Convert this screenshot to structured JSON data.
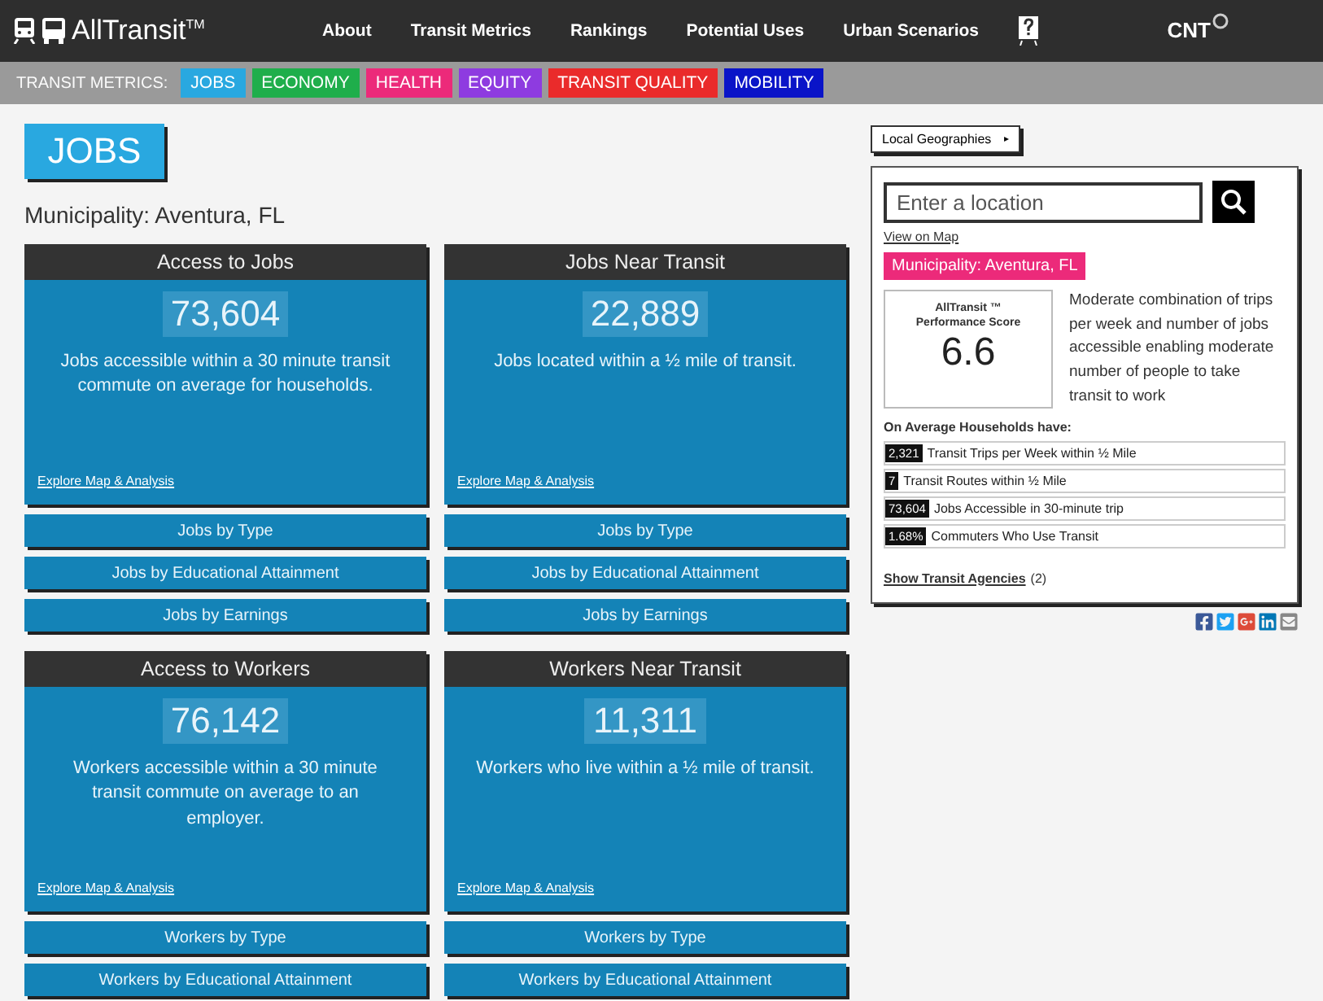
{
  "header": {
    "brand": "AllTransit",
    "brand_mark": "TM",
    "nav": [
      "About",
      "Transit Metrics",
      "Rankings",
      "Potential Uses",
      "Urban Scenarios"
    ],
    "partner_logo": "CNT"
  },
  "metrics_bar": {
    "label": "TRANSIT METRICS:",
    "tabs": [
      {
        "label": "JOBS",
        "color": "#29a8e0"
      },
      {
        "label": "ECONOMY",
        "color": "#1fae4b"
      },
      {
        "label": "HEALTH",
        "color": "#ec2a7a"
      },
      {
        "label": "EQUITY",
        "color": "#8e3be0"
      },
      {
        "label": "TRANSIT QUALITY",
        "color": "#ea2b2b"
      },
      {
        "label": "MOBILITY",
        "color": "#0a14c8"
      }
    ]
  },
  "page_title": "JOBS",
  "place_heading": "Municipality: Aventura, FL",
  "cards": [
    {
      "title": "Access to Jobs",
      "value": "73,604",
      "description": "Jobs accessible within a 30 minute transit commute on average for households.",
      "link": "Explore Map & Analysis",
      "buttons": [
        "Jobs by Type",
        "Jobs by Educational Attainment",
        "Jobs by Earnings"
      ]
    },
    {
      "title": "Jobs Near Transit",
      "value": "22,889",
      "description": "Jobs located within a ½ mile of transit.",
      "link": "Explore Map & Analysis",
      "buttons": [
        "Jobs by Type",
        "Jobs by Educational Attainment",
        "Jobs by Earnings"
      ]
    },
    {
      "title": "Access to Workers",
      "value": "76,142",
      "description": "Workers accessible within a 30 minute transit commute on average to an employer.",
      "link": "Explore Map & Analysis",
      "buttons": [
        "Workers by Type",
        "Workers by Educational Attainment"
      ]
    },
    {
      "title": "Workers Near Transit",
      "value": "11,311",
      "description": "Workers who live within a ½ mile of transit.",
      "link": "Explore Map & Analysis",
      "buttons": [
        "Workers by Type",
        "Workers by Educational Attainment"
      ]
    }
  ],
  "sidebar": {
    "dropdown": "Local Geographies",
    "dropdown_caret": "▸",
    "search": {
      "placeholder": "Enter a location"
    },
    "view_on_map": "View on Map",
    "place_tag": "Municipality: Aventura, FL",
    "score": {
      "label": "AllTransit",
      "label_mark": "™",
      "label_line2": "Performance Score",
      "value": "6.6",
      "description": "Moderate combination of trips per week and number of jobs accessible enabling moderate number of people to take transit to work"
    },
    "stats_heading": "On Average Households have:",
    "stats": [
      {
        "value": "2,321",
        "label": "Transit Trips per Week within ½ Mile"
      },
      {
        "value": "7",
        "label": "Transit Routes within ½ Mile"
      },
      {
        "value": "73,604",
        "label": "Jobs Accessible in 30-minute trip"
      },
      {
        "value": "1.68%",
        "label": "Commuters Who Use Transit"
      }
    ],
    "agencies_link": "Show Transit Agencies",
    "agencies_count": "(2)"
  }
}
